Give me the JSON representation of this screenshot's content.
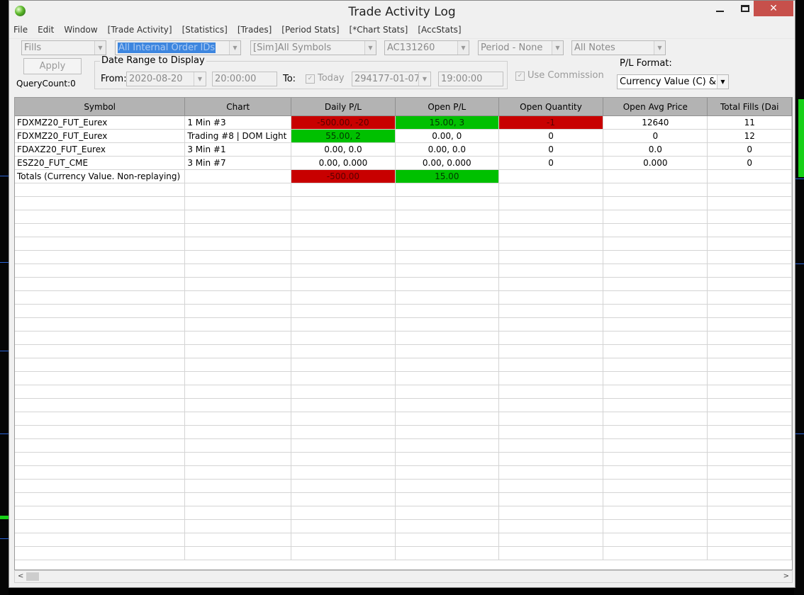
{
  "window": {
    "title": "Trade Activity Log"
  },
  "menu": [
    "File",
    "Edit",
    "Window",
    "[Trade Activity]",
    "[Statistics]",
    "[Trades]",
    "[Period Stats]",
    "[*Chart Stats]",
    "[AccStats]"
  ],
  "filters": {
    "type": "Fills",
    "order_ids": "All Internal Order IDs",
    "symbols": "[Sim]All Symbols",
    "account": "AC131260",
    "period": "Period - None",
    "notes": "All Notes"
  },
  "apply_label": "Apply",
  "query_count": "QueryCount:0",
  "date_range": {
    "label": "Date Range to Display",
    "from_label": "From:",
    "from_date": "2020-08-20",
    "from_time": "20:00:00",
    "to_label": "To:",
    "today_label": "Today",
    "to_date": "294177-01-07",
    "to_time": "19:00:00"
  },
  "use_commission": "Use Commission",
  "pl_format": {
    "label": "P/L Format:",
    "value": "Currency Value (C) & P"
  },
  "columns": [
    "Symbol",
    "Chart",
    "Daily P/L",
    "Open P/L",
    "Open Quantity",
    "Open Avg Price",
    "Total Fills (Dai"
  ],
  "rows": [
    {
      "symbol": "FDXMZ20_FUT_Eurex",
      "chart": "1 Min  #3",
      "daily": "-500.00, -20",
      "open": "15.00, 3",
      "qty": "-1",
      "avg": "12640",
      "fills": "11",
      "daily_color": "red",
      "open_color": "green",
      "qty_color": "red"
    },
    {
      "symbol": "FDXMZ20_FUT_Eurex",
      "chart": "Trading  #8 | DOM Light",
      "daily": "55.00, 2",
      "open": "0.00, 0",
      "qty": "0",
      "avg": "0",
      "fills": "12",
      "daily_color": "green",
      "open_color": "",
      "qty_color": ""
    },
    {
      "symbol": "FDAXZ20_FUT_Eurex",
      "chart": "3 Min  #1",
      "daily": "0.00, 0.0",
      "open": "0.00, 0.0",
      "qty": "0",
      "avg": "0.0",
      "fills": "0",
      "daily_color": "",
      "open_color": "",
      "qty_color": ""
    },
    {
      "symbol": "ESZ20_FUT_CME",
      "chart": "3 Min  #7",
      "daily": "0.00, 0.000",
      "open": "0.00, 0.000",
      "qty": "0",
      "avg": "0.000",
      "fills": "0",
      "daily_color": "",
      "open_color": "",
      "qty_color": ""
    },
    {
      "symbol": "Totals (Currency Value. Non-replaying)",
      "chart": "",
      "daily": "-500.00",
      "open": "15.00",
      "qty": "",
      "avg": "",
      "fills": "",
      "daily_color": "red",
      "open_color": "green",
      "qty_color": ""
    }
  ],
  "colors": {
    "red": "#c80000",
    "green": "#00c000",
    "header": "#b3b3b3",
    "close_button": "#c7504b"
  }
}
